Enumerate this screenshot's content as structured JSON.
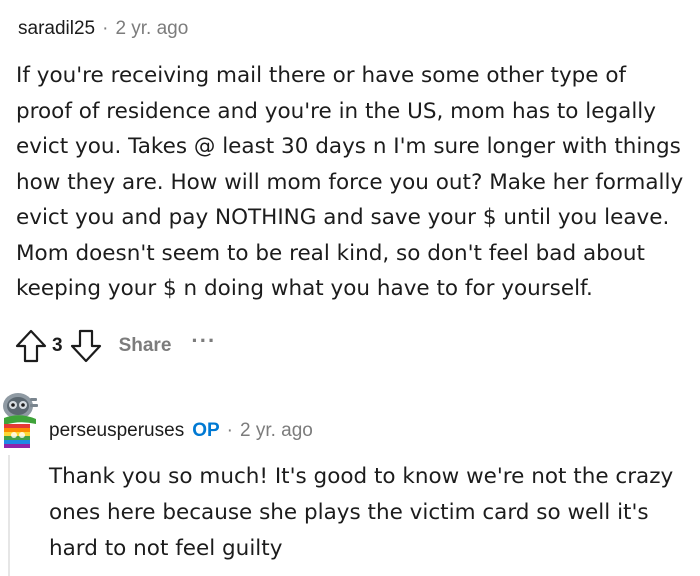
{
  "comment": {
    "username": "saradil25",
    "separator": "·",
    "time": "2 yr. ago",
    "body_lines": [
      "If you're receiving mail there or have some other type of",
      "proof of residence and you're in the US, mom has to legally",
      "evict you. Takes @ least 30 days n I'm sure longer with things",
      "how they are. How will mom force you out? Make her formally",
      "evict you and pay NOTHING and save your $ until you leave.",
      "Mom doesn't seem to be real kind, so don't feel bad about",
      "keeping your $ n doing what you have to for yourself."
    ],
    "actions": {
      "score": "3",
      "share_label": "Share",
      "more_label": "···",
      "upvote_icon": "upvote-arrow-icon",
      "downvote_icon": "downvote-arrow-icon"
    }
  },
  "reply": {
    "username": "perseusperuses",
    "badge": "OP",
    "separator": "·",
    "time": "2 yr. ago",
    "avatar_icon": "snoo-avatar-icon",
    "body_lines": [
      "Thank you so much! It's good to know we're not the crazy",
      "ones here because she plays the victim card so well it's",
      "hard to not feel guilty"
    ]
  },
  "colors": {
    "text": "#1c1c1c",
    "meta": "#7c7c7c",
    "op_badge": "#0079d3",
    "thread_line": "#e6e6e6"
  }
}
